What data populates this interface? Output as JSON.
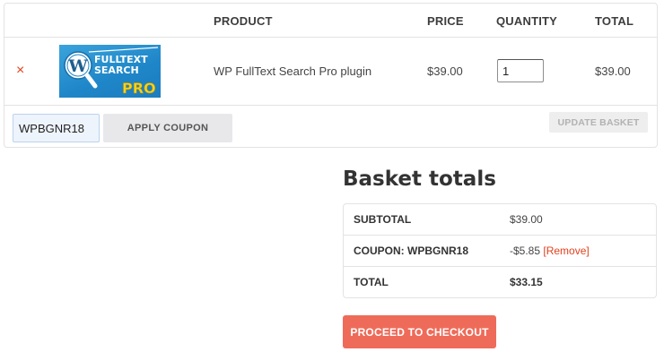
{
  "cart": {
    "headers": {
      "product": "PRODUCT",
      "price": "PRICE",
      "quantity": "QUANTITY",
      "total": "TOTAL"
    },
    "item": {
      "remove_symbol": "×",
      "name": "WP FullText Search Pro plugin",
      "price": "$39.00",
      "quantity": "1",
      "total": "$39.00",
      "thumbnail": {
        "line1": "FULLTEXT",
        "line2": "SEARCH",
        "line3": "PRO",
        "logo_letter": "W"
      }
    },
    "coupon": {
      "value": "WPBGNR18",
      "apply_label": "APPLY COUPON"
    },
    "update_label": "UPDATE BASKET"
  },
  "totals": {
    "title": "Basket totals",
    "rows": [
      {
        "label": "SUBTOTAL",
        "value": "$39.00"
      },
      {
        "label": "COUPON: WPBGNR18",
        "value": "-$5.85",
        "link": "[Remove]"
      },
      {
        "label": "TOTAL",
        "value": "$33.15"
      }
    ]
  },
  "checkout_label": "PROCEED TO CHECKOUT",
  "colors": {
    "accent": "#ef6b59",
    "remove": "#e2401c",
    "thumb_blue": "#1e86c8",
    "pro_yellow": "#f5d31c"
  }
}
